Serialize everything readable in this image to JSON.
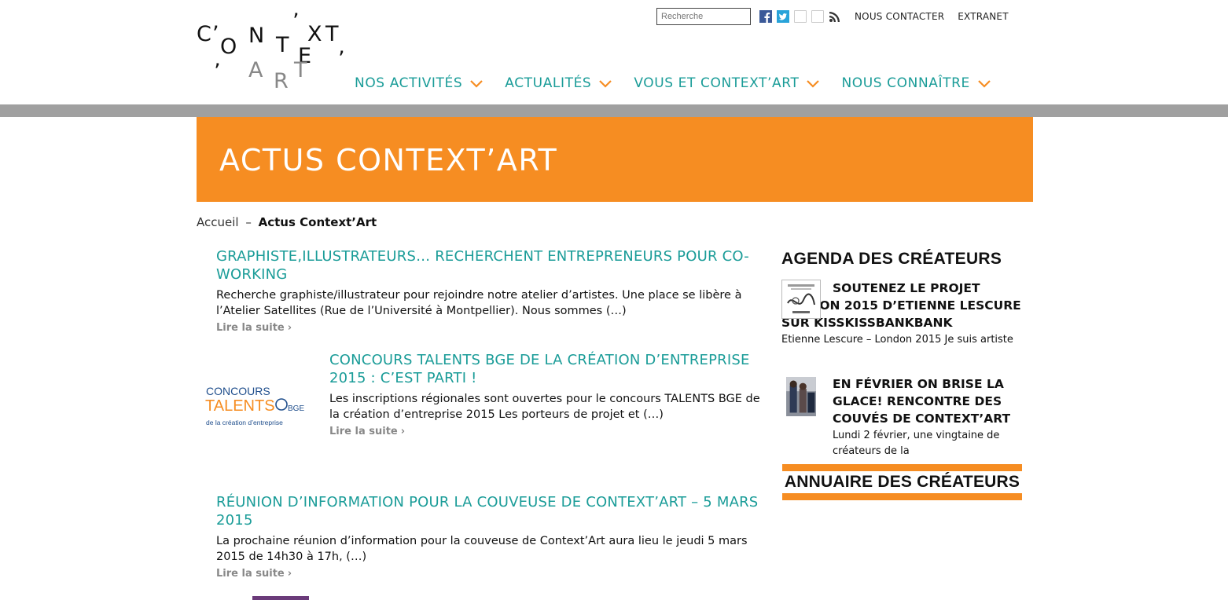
{
  "logo": {
    "letters": [
      "C",
      "O",
      "N",
      "T",
      "E",
      "X",
      "T",
      "A",
      "R",
      "T"
    ],
    "apostrophes": [
      "’",
      "’",
      "’",
      "’"
    ]
  },
  "topbar": {
    "search_placeholder": "Recherche",
    "links": [
      "NOUS CONTACTER",
      "EXTRANET"
    ]
  },
  "nav": [
    "NOS ACTIVITÉS",
    "ACTUALITÉS",
    "VOUS ET CONTEXT’ART",
    "NOUS CONNAÎTRE"
  ],
  "colors": {
    "teal": "#1a9c98",
    "orange": "#f68d22",
    "grey": "#a0a0a0"
  },
  "banner": {
    "title": "ACTUS CONTEXT’ART"
  },
  "breadcrumb": {
    "home": "Accueil",
    "separator": "–",
    "current": "Actus Context’Art"
  },
  "articles": [
    {
      "title": "GRAPHISTE,ILLUSTRATEURS… RECHERCHENT ENTREPRENEURS POUR CO-WORKING",
      "excerpt": "Recherche graphiste/illustrateur pour rejoindre notre atelier d’artistes.  Une place se libère à l’Atelier Satellites (Rue de l’Université à Montpellier). Nous sommes (…)",
      "more": "Lire la suite"
    },
    {
      "title": "CONCOURS TALENTS BGE DE LA CRÉATION D’ENTREPRISE 2015 : C’EST PARTI !",
      "excerpt": "Les inscriptions régionales sont ouvertes pour le concours TALENTS BGE de la création d’entreprise 2015 Les porteurs de projet et (…)",
      "more": "Lire la suite",
      "thumb": {
        "line1": "CONCOURS",
        "line2": "TALENTS",
        "badge": "BGE",
        "caption": "de la création d’entreprise"
      }
    },
    {
      "title": "RÉUNION D’INFORMATION POUR LA COUVEUSE DE CONTEXT’ART – 5 MARS 2015",
      "excerpt": "La prochaine réunion d’information pour la couveuse de Context’Art aura lieu le jeudi 5 mars 2015 de 14h30 à 17h, (…)",
      "more": "Lire la suite"
    }
  ],
  "sidebar": {
    "agenda_title": "AGENDA DES CRÉATEURS",
    "items": [
      {
        "title": "SOUTENEZ LE PROJET LONDON 2015 D’ETIENNE LESCURE SUR KISSKISSBANKBANK",
        "text": "Etienne Lescure – London 2015 Je suis artiste"
      },
      {
        "title": "EN FÉVRIER ON BRISE LA GLACE! RENCONTRE DES COUVÉS DE CONTEXT’ART",
        "text": "Lundi 2 février, une vingtaine de créateurs de la"
      }
    ],
    "annuaire": "ANNUAIRE DES CRÉATEURS"
  }
}
